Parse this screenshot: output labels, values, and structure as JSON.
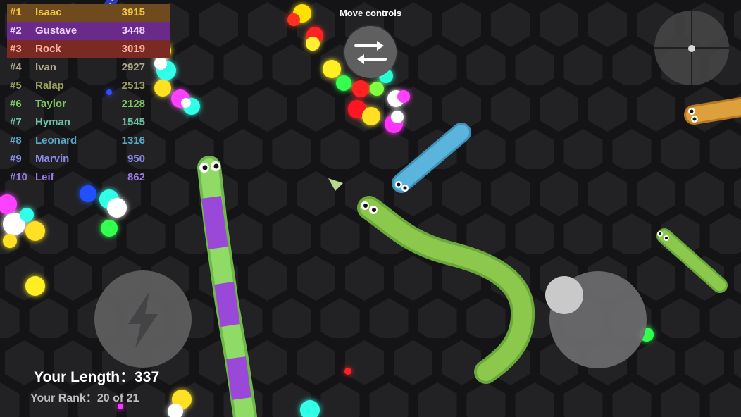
{
  "leaderboard": {
    "entries": [
      {
        "rank": "#1",
        "name": "Isaac",
        "score": "3915",
        "color": "#f0c840",
        "highlight": "#6e4a1e"
      },
      {
        "rank": "#2",
        "name": "Gustave",
        "score": "3448",
        "color": "#e8d0ff",
        "highlight": "#6a2a8a"
      },
      {
        "rank": "#3",
        "name": "Rock",
        "score": "3019",
        "color": "#ffb0a0",
        "highlight": "#7a2a22"
      },
      {
        "rank": "#4",
        "name": "Ivan",
        "score": "2927",
        "color": "#b0a888",
        "highlight": ""
      },
      {
        "rank": "#5",
        "name": "Ralap",
        "score": "2513",
        "color": "#9aa060",
        "highlight": ""
      },
      {
        "rank": "#6",
        "name": "Taylor",
        "score": "2128",
        "color": "#7bc860",
        "highlight": ""
      },
      {
        "rank": "#7",
        "name": "Hyman",
        "score": "1545",
        "color": "#6cc0a0",
        "highlight": ""
      },
      {
        "rank": "#8",
        "name": "Leonard",
        "score": "1316",
        "color": "#5aa8c8",
        "highlight": ""
      },
      {
        "rank": "#9",
        "name": "Marvin",
        "score": "950",
        "color": "#8a8ae8",
        "highlight": ""
      },
      {
        "rank": "#10",
        "name": "Leif",
        "score": "862",
        "color": "#9a7ae0",
        "highlight": ""
      }
    ]
  },
  "controls": {
    "move_label": "Move controls",
    "move_icon": "swap-arrows-icon",
    "boost_icon": "lightning-icon"
  },
  "stats": {
    "length_label": "Your Length：",
    "length_value": "337",
    "rank_label": "Your Rank：",
    "rank_value": "20 of 21"
  },
  "colors": {
    "background": "#141416",
    "hex_cell": "#222225",
    "player_snake": "#8cc84b",
    "striped_snake_green": "#8cd860",
    "striped_snake_purple": "#8c3cc8",
    "blue_snake": "#5ab4dc",
    "orange_snake": "#dca03c"
  }
}
